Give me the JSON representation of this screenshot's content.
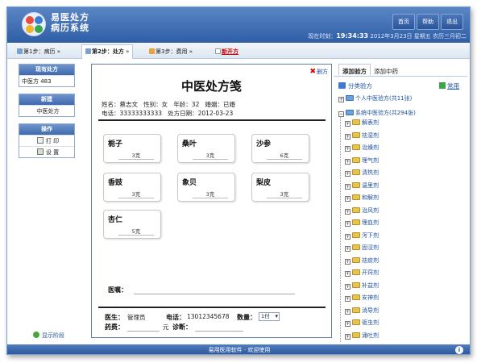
{
  "header": {
    "title_line1": "易医处方",
    "title_line2": "病历系统",
    "nav": [
      "首页",
      "帮助",
      "退出"
    ],
    "status_label": "现在时刻：",
    "status_time": "19:34:33",
    "status_date": "2012年3月23日 星期五 农历三月初二"
  },
  "steps": {
    "step1": "第1步：病历",
    "step2": "第2步：处方",
    "step3": "第3步：费用",
    "new_rx": "新开方"
  },
  "sidebar": {
    "existing_header": "现有处方",
    "existing_item": "中医方 483",
    "new_header": "新建",
    "new_item": "中医处方",
    "ops_header": "操作",
    "print": "打 印",
    "settings": "设 置",
    "show_stage": "显示阶段"
  },
  "prescription": {
    "delete_label": "删方",
    "title": "中医处方笺",
    "info_line1": "姓名：蔡志文   性别：女   年龄：32   婚姻：已婚",
    "info_line2": "电话：33333333333   处方日期：2012-03-23",
    "herbs": [
      {
        "name": "栀子",
        "dose": "3克"
      },
      {
        "name": "桑叶",
        "dose": "3克"
      },
      {
        "name": "沙参",
        "dose": "6克"
      },
      {
        "name": "香豉",
        "dose": "3克"
      },
      {
        "name": "象贝",
        "dose": "3克"
      },
      {
        "name": "梨皮",
        "dose": "3克"
      },
      {
        "name": "杏仁",
        "dose": "5克"
      }
    ],
    "advice_label": "医嘱：",
    "doctor_label": "医生：",
    "doctor_value": "管理员",
    "phone_label": "电话：",
    "phone_value": "13012345678",
    "qty_label": "数量：",
    "qty_value": "1付",
    "fee_label": "药费：",
    "fee_unit": "元",
    "diag_label": "诊断："
  },
  "right_panel": {
    "tab_active": "添加验方",
    "tab_other": "添加中药",
    "category_header": "分类验方",
    "common_label": "常用",
    "personal": "个人中医验方(共11张)",
    "system": "系统中医验方(共294张)",
    "categories": [
      "解表剂",
      "祛湿剂",
      "治燥剂",
      "理气剂",
      "清热剂",
      "温里剂",
      "和解剂",
      "治风剂",
      "理血剂",
      "泻下剂",
      "固涩剂",
      "祛痰剂",
      "开窍剂",
      "补益剂",
      "安神剂",
      "消导剂",
      "驱虫剂",
      "涌吐剂"
    ]
  },
  "footer": {
    "text": "易用医用软件 · 欢迎使用"
  },
  "colors": {
    "header_blue": "#2f5ea6",
    "link_blue": "#1d4fa0",
    "accent_red": "#cc0000"
  }
}
